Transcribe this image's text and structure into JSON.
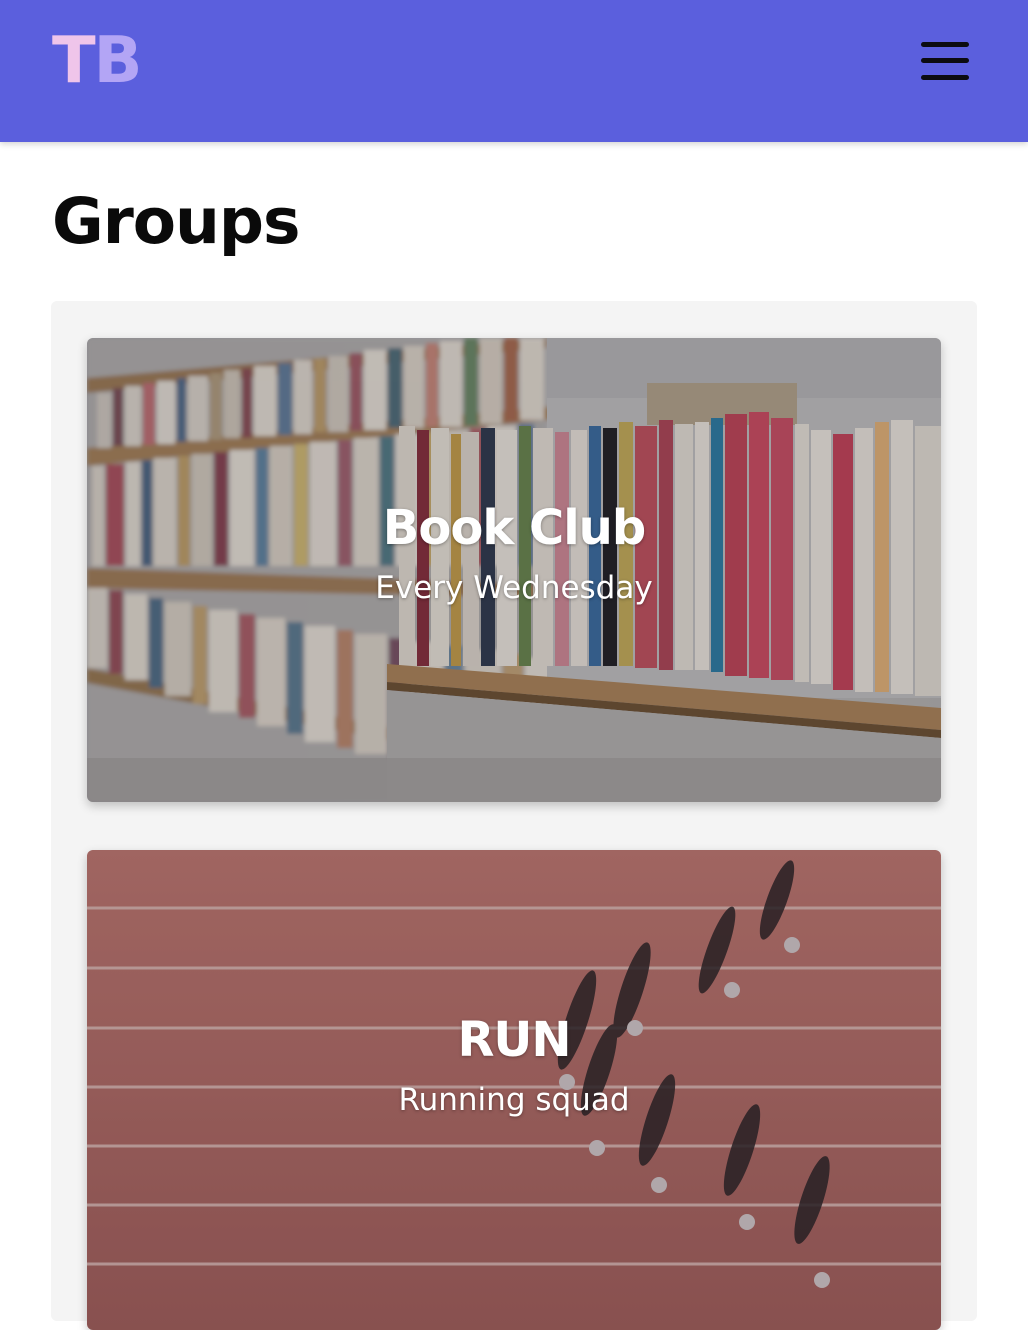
{
  "header": {
    "logo_t": "T",
    "logo_b": "B",
    "menu_icon": "hamburger-menu-icon",
    "background": "#5b5fdd"
  },
  "page": {
    "title": "Groups"
  },
  "groups": [
    {
      "title": "Book Club",
      "subtitle": "Every Wednesday",
      "image": "bookshelf-photo"
    },
    {
      "title": "RUN",
      "subtitle": "Running squad",
      "image": "running-track-photo"
    }
  ]
}
